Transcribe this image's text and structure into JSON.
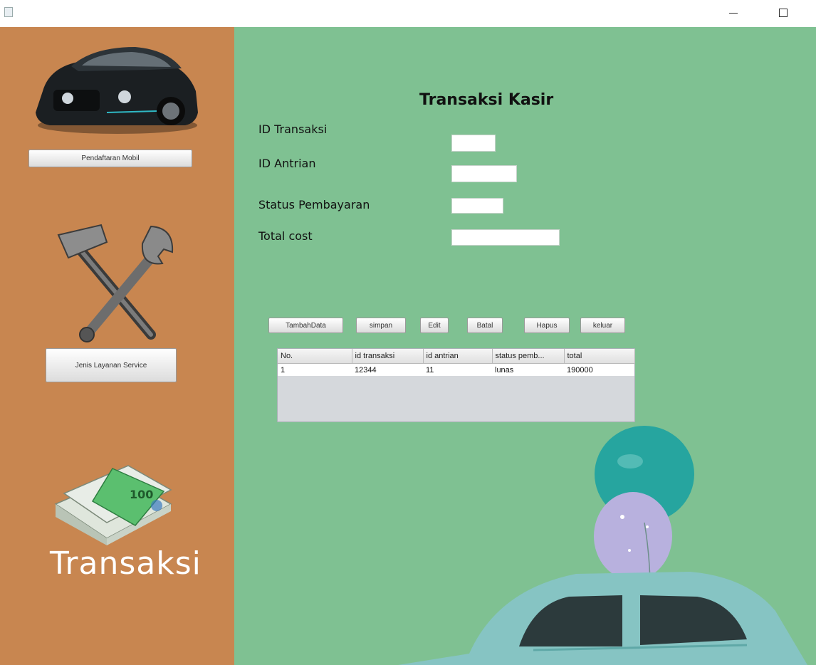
{
  "window": {
    "minimize_glyph": "–",
    "maximize_glyph": "□"
  },
  "sidebar": {
    "pendaftaran_button": "Pendaftaran Mobil",
    "layanan_button": "Jenis Layanan Service",
    "transaksi_label": "Transaksi",
    "icons": [
      "car-image-icon",
      "hammer-wrench-icon",
      "money-stack-icon"
    ]
  },
  "main": {
    "title": "Transaksi Kasir",
    "fields": {
      "id_transaksi_label": "ID Transaksi",
      "id_antrian_label": "ID Antrian",
      "status_label": "Status Pembayaran",
      "total_label": "Total cost",
      "id_transaksi_value": "",
      "id_antrian_value": "",
      "status_value": "",
      "total_value": ""
    },
    "buttons": {
      "tambah": "TambahData",
      "simpan": "simpan",
      "edit": "Edit",
      "batal": "Batal",
      "hapus": "Hapus",
      "keluar": "keluar"
    },
    "table": {
      "headers": [
        "No.",
        "id transaksi",
        "id antrian",
        "status pemb...",
        "total"
      ],
      "rows": [
        [
          "1",
          "12344",
          "11",
          "lunas",
          "190000"
        ]
      ]
    }
  },
  "colors": {
    "sidebar": "#c88650",
    "main": "#7fc192",
    "balloon_teal": "#2aa7a1",
    "balloon_lilac": "#b7b0dd",
    "car": "#86c4c3"
  }
}
